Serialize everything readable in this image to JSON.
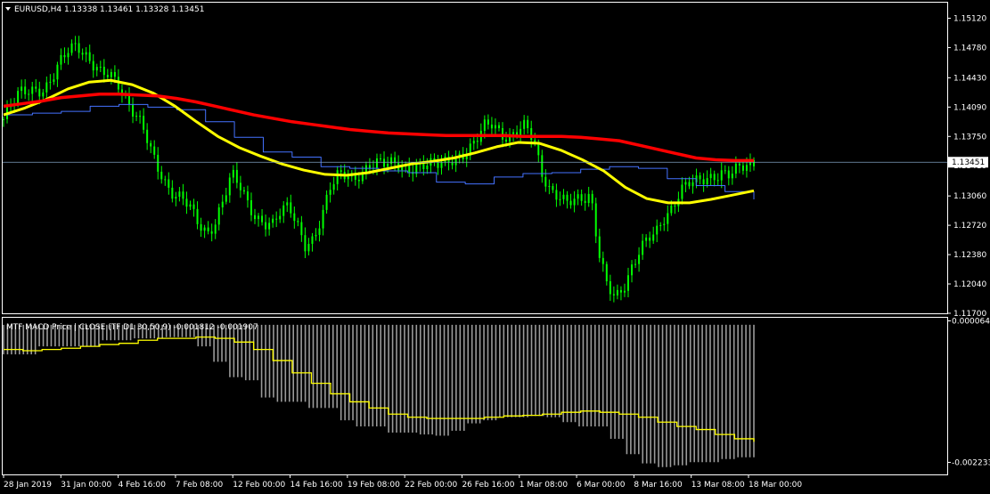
{
  "window": {
    "header_text": "EURUSD,H4  1.13338 1.13461 1.13328 1.13451",
    "sub_header_text": "MTF MACD Price  | CLOSE  (TF D1 30,50,9) -0.001812 -0.001907"
  },
  "colors": {
    "background": "#000000",
    "candles": "#00ff00",
    "sma_red": "#ff0000",
    "ma_yellow": "#ffff00",
    "thin_blue": "#4472ff",
    "histogram": "#9a9a9a",
    "signal": "#ffff00",
    "frame": "#ffffff",
    "price_line": "#7f9fbf"
  },
  "icons": {
    "menu": "triangle-down-icon"
  },
  "chart_data": [
    {
      "type": "candlestick",
      "title": "EURUSD,H4  1.13338 1.13461 1.13328 1.13451",
      "ylim": [
        1.1171,
        1.1529
      ],
      "y_ticks": [
        "1.15120",
        "1.14780",
        "1.14430",
        "1.14090",
        "1.13750",
        "1.13410",
        "1.13060",
        "1.12720",
        "1.12380",
        "1.12040",
        "1.11700"
      ],
      "current_price": "1.13451",
      "x_ticks": [
        "28 Jan 2019",
        "31 Jan 00:00",
        "4 Feb 16:00",
        "7 Feb 08:00",
        "12 Feb 00:00",
        "14 Feb 16:00",
        "19 Feb 08:00",
        "22 Feb 00:00",
        "26 Feb 16:00",
        "1 Mar 08:00",
        "6 Mar 00:00",
        "8 Mar 16:00",
        "13 Mar 08:00",
        "18 Mar 00:00"
      ],
      "close_path": [
        1.1395,
        1.141,
        1.1425,
        1.143,
        1.1432,
        1.1428,
        1.144,
        1.146,
        1.1478,
        1.1485,
        1.147,
        1.1455,
        1.1445,
        1.1448,
        1.144,
        1.142,
        1.14,
        1.1385,
        1.136,
        1.134,
        1.132,
        1.1305,
        1.13,
        1.129,
        1.1275,
        1.1265,
        1.1275,
        1.13,
        1.133,
        1.132,
        1.13,
        1.128,
        1.127,
        1.127,
        1.129,
        1.13,
        1.1275,
        1.1245,
        1.125,
        1.128,
        1.132,
        1.1335,
        1.133,
        1.132,
        1.133,
        1.1345,
        1.135,
        1.1345,
        1.134,
        1.1335,
        1.1338,
        1.1345,
        1.1345,
        1.134,
        1.1342,
        1.1348,
        1.1355,
        1.136,
        1.137,
        1.1385,
        1.139,
        1.138,
        1.1375,
        1.138,
        1.1385,
        1.137,
        1.1335,
        1.1315,
        1.1305,
        1.1295,
        1.13,
        1.1305,
        1.131,
        1.124,
        1.12,
        1.1185,
        1.12,
        1.1225,
        1.1245,
        1.1255,
        1.126,
        1.128,
        1.1295,
        1.1315,
        1.132,
        1.132,
        1.1325,
        1.133,
        1.1335,
        1.133,
        1.1335,
        1.134,
        1.1345
      ],
      "series": [
        {
          "name": "",
          "values": [
            1.141,
            1.1413,
            1.1416,
            1.142,
            1.1422,
            1.1424,
            1.1424,
            1.1423,
            1.1422,
            1.1419,
            1.1415,
            1.141,
            1.1405,
            1.14,
            1.1396,
            1.1392,
            1.1389,
            1.1386,
            1.1383,
            1.1381,
            1.1379,
            1.1378,
            1.1377,
            1.1376,
            1.1376,
            1.1376,
            1.1376,
            1.1375,
            1.1375,
            1.1375,
            1.1374,
            1.1372,
            1.137,
            1.1365,
            1.136,
            1.1355,
            1.135,
            1.1348,
            1.1347,
            1.1347
          ]
        },
        {
          "name": "",
          "values": [
            1.14,
            1.1408,
            1.1418,
            1.143,
            1.1438,
            1.144,
            1.1435,
            1.1425,
            1.141,
            1.1392,
            1.1375,
            1.1362,
            1.1352,
            1.1343,
            1.1336,
            1.1331,
            1.133,
            1.1333,
            1.1338,
            1.1343,
            1.1346,
            1.135,
            1.1356,
            1.1363,
            1.1368,
            1.1367,
            1.1359,
            1.1348,
            1.1335,
            1.1316,
            1.1303,
            1.1298,
            1.1298,
            1.1302,
            1.1307,
            1.1312
          ]
        },
        {
          "name": "",
          "values": [
            1.14,
            1.1402,
            1.1404,
            1.141,
            1.1412,
            1.1409,
            1.1406,
            1.1392,
            1.1374,
            1.1357,
            1.1351,
            1.134,
            1.1338,
            1.1335,
            1.1333,
            1.1322,
            1.132,
            1.1328,
            1.1332,
            1.1333,
            1.1337,
            1.134,
            1.1338,
            1.1326,
            1.1318,
            1.1311,
            1.1302
          ]
        }
      ]
    },
    {
      "type": "bar",
      "title": "MTF MACD Price  | CLOSE  (TF D1 30,50,9) -0.001812 -0.001907",
      "ylim": [
        -0.0024,
        0.0001
      ],
      "y_ticks": [
        "0.000064",
        "-0.002233"
      ],
      "histogram_values": [
        -0.00048,
        -0.00048,
        -0.00035,
        -0.00035,
        -0.00035,
        -0.00035,
        -0.00025,
        -0.00025,
        -0.00022,
        -0.00022,
        -0.0002,
        -0.0002,
        -0.00035,
        -0.0006,
        -0.00085,
        -0.0009,
        -0.00118,
        -0.00125,
        -0.00125,
        -0.00135,
        -0.00135,
        -0.00155,
        -0.00165,
        -0.00165,
        -0.00175,
        -0.00175,
        -0.00178,
        -0.0018,
        -0.00172,
        -0.0016,
        -0.00155,
        -0.0015,
        -0.0015,
        -0.00148,
        -0.0015,
        -0.00158,
        -0.00165,
        -0.00165,
        -0.00185,
        -0.0021,
        -0.00225,
        -0.00231,
        -0.00228,
        -0.00223,
        -0.00223,
        -0.00218,
        -0.00215
      ],
      "signal_values": [
        -0.0004,
        -0.00042,
        -0.0004,
        -0.00038,
        -0.00035,
        -0.00032,
        -0.0003,
        -0.00025,
        -0.00022,
        -0.00022,
        -0.0002,
        -0.00022,
        -0.00028,
        -0.0004,
        -0.00058,
        -0.00078,
        -0.00095,
        -0.00112,
        -0.00125,
        -0.00135,
        -0.00145,
        -0.0015,
        -0.00152,
        -0.00152,
        -0.00152,
        -0.0015,
        -0.00148,
        -0.00147,
        -0.00145,
        -0.00142,
        -0.0014,
        -0.00142,
        -0.00145,
        -0.0015,
        -0.00158,
        -0.00165,
        -0.0017,
        -0.00178,
        -0.00185,
        -0.0019
      ]
    }
  ]
}
